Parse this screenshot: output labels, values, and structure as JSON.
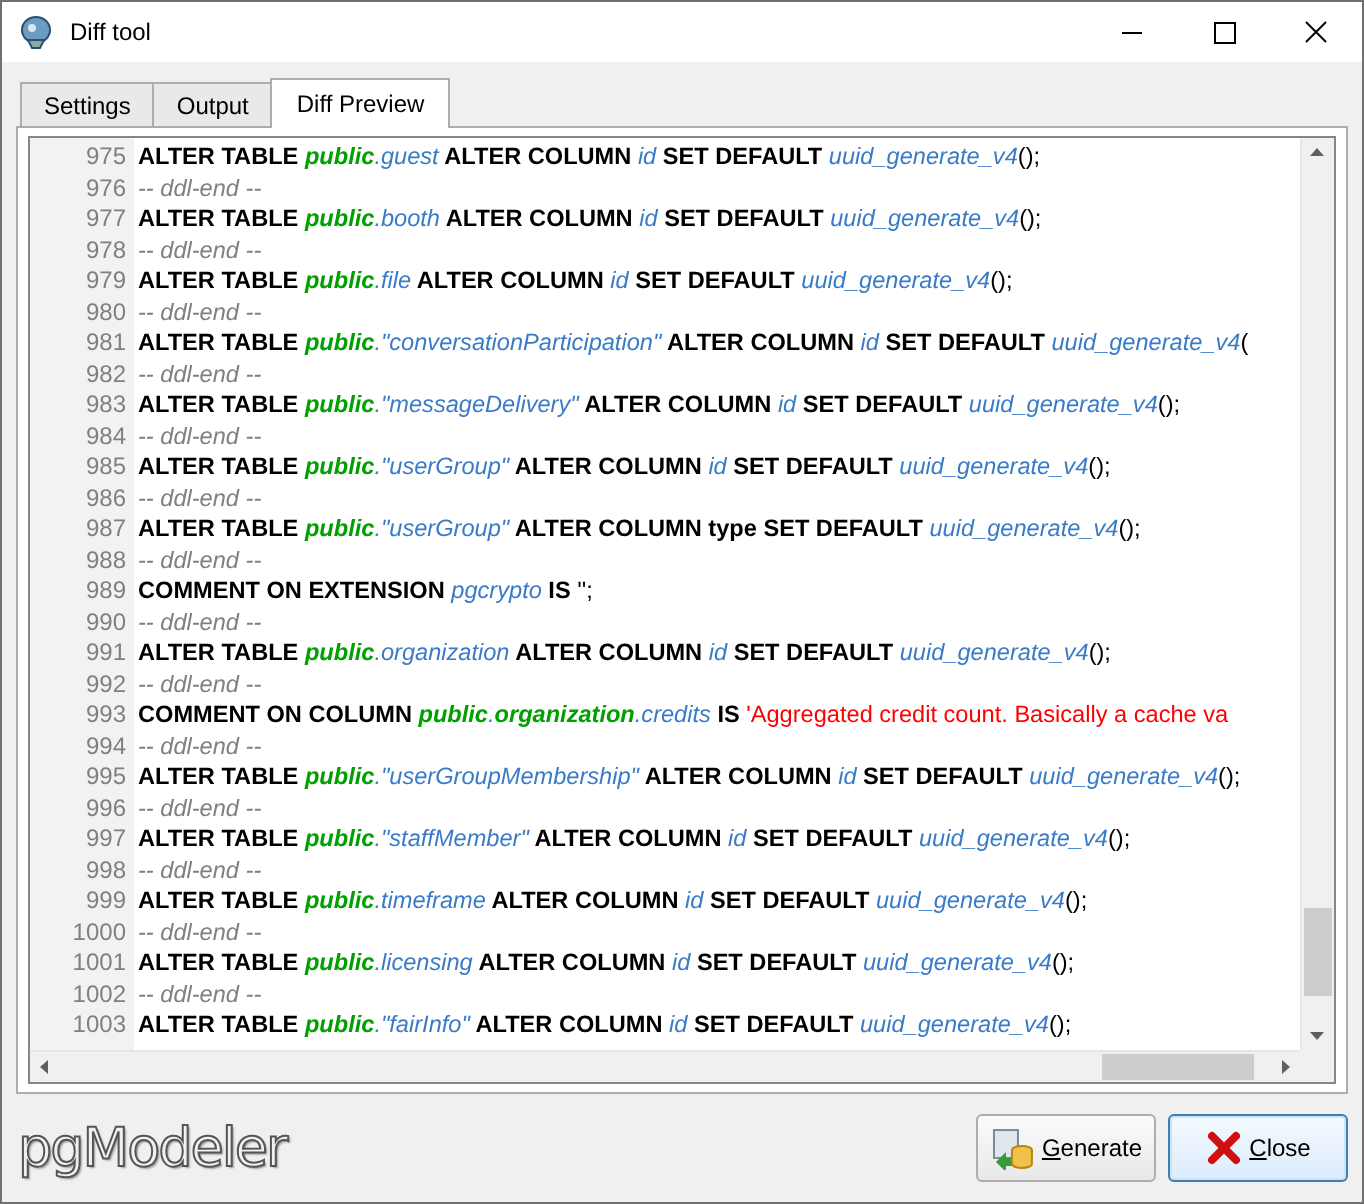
{
  "window": {
    "title": "Diff tool"
  },
  "tabs": [
    {
      "label": "Settings",
      "selected": false
    },
    {
      "label": "Output",
      "selected": false
    },
    {
      "label": "Diff Preview",
      "selected": true
    }
  ],
  "code_lines": [
    {
      "number": "975",
      "segments": [
        {
          "kind": "keyword",
          "text": "ALTER TABLE "
        },
        {
          "kind": "schema",
          "text": "public"
        },
        {
          "kind": "ident",
          "text": ".guest"
        },
        {
          "kind": "keyword",
          "text": " ALTER COLUMN "
        },
        {
          "kind": "ident",
          "text": "id"
        },
        {
          "kind": "keyword",
          "text": " SET DEFAULT "
        },
        {
          "kind": "ident",
          "text": "uuid_generate_v4"
        },
        {
          "kind": "plain",
          "text": "();"
        }
      ]
    },
    {
      "number": "976",
      "segments": [
        {
          "kind": "comment",
          "text": "-- ddl-end --"
        }
      ]
    },
    {
      "number": "977",
      "segments": [
        {
          "kind": "keyword",
          "text": "ALTER TABLE "
        },
        {
          "kind": "schema",
          "text": "public"
        },
        {
          "kind": "ident",
          "text": ".booth"
        },
        {
          "kind": "keyword",
          "text": " ALTER COLUMN "
        },
        {
          "kind": "ident",
          "text": "id"
        },
        {
          "kind": "keyword",
          "text": " SET DEFAULT "
        },
        {
          "kind": "ident",
          "text": "uuid_generate_v4"
        },
        {
          "kind": "plain",
          "text": "();"
        }
      ]
    },
    {
      "number": "978",
      "segments": [
        {
          "kind": "comment",
          "text": "-- ddl-end --"
        }
      ]
    },
    {
      "number": "979",
      "segments": [
        {
          "kind": "keyword",
          "text": "ALTER TABLE "
        },
        {
          "kind": "schema",
          "text": "public"
        },
        {
          "kind": "ident",
          "text": ".file"
        },
        {
          "kind": "keyword",
          "text": " ALTER COLUMN "
        },
        {
          "kind": "ident",
          "text": "id"
        },
        {
          "kind": "keyword",
          "text": " SET DEFAULT "
        },
        {
          "kind": "ident",
          "text": "uuid_generate_v4"
        },
        {
          "kind": "plain",
          "text": "();"
        }
      ]
    },
    {
      "number": "980",
      "segments": [
        {
          "kind": "comment",
          "text": "-- ddl-end --"
        }
      ]
    },
    {
      "number": "981",
      "segments": [
        {
          "kind": "keyword",
          "text": "ALTER TABLE "
        },
        {
          "kind": "schema",
          "text": "public"
        },
        {
          "kind": "ident",
          "text": ".\"conversationParticipation\""
        },
        {
          "kind": "keyword",
          "text": " ALTER COLUMN "
        },
        {
          "kind": "ident",
          "text": "id"
        },
        {
          "kind": "keyword",
          "text": " SET DEFAULT "
        },
        {
          "kind": "ident",
          "text": "uuid_generate_v4"
        },
        {
          "kind": "plain",
          "text": "("
        }
      ]
    },
    {
      "number": "982",
      "segments": [
        {
          "kind": "comment",
          "text": "-- ddl-end --"
        }
      ]
    },
    {
      "number": "983",
      "segments": [
        {
          "kind": "keyword",
          "text": "ALTER TABLE "
        },
        {
          "kind": "schema",
          "text": "public"
        },
        {
          "kind": "ident",
          "text": ".\"messageDelivery\""
        },
        {
          "kind": "keyword",
          "text": " ALTER COLUMN "
        },
        {
          "kind": "ident",
          "text": "id"
        },
        {
          "kind": "keyword",
          "text": " SET DEFAULT "
        },
        {
          "kind": "ident",
          "text": "uuid_generate_v4"
        },
        {
          "kind": "plain",
          "text": "();"
        }
      ]
    },
    {
      "number": "984",
      "segments": [
        {
          "kind": "comment",
          "text": "-- ddl-end --"
        }
      ]
    },
    {
      "number": "985",
      "segments": [
        {
          "kind": "keyword",
          "text": "ALTER TABLE "
        },
        {
          "kind": "schema",
          "text": "public"
        },
        {
          "kind": "ident",
          "text": ".\"userGroup\""
        },
        {
          "kind": "keyword",
          "text": " ALTER COLUMN "
        },
        {
          "kind": "ident",
          "text": "id"
        },
        {
          "kind": "keyword",
          "text": " SET DEFAULT "
        },
        {
          "kind": "ident",
          "text": "uuid_generate_v4"
        },
        {
          "kind": "plain",
          "text": "();"
        }
      ]
    },
    {
      "number": "986",
      "segments": [
        {
          "kind": "comment",
          "text": "-- ddl-end --"
        }
      ]
    },
    {
      "number": "987",
      "segments": [
        {
          "kind": "keyword",
          "text": "ALTER TABLE "
        },
        {
          "kind": "schema",
          "text": "public"
        },
        {
          "kind": "ident",
          "text": ".\"userGroup\""
        },
        {
          "kind": "keyword",
          "text": " ALTER COLUMN type SET DEFAULT "
        },
        {
          "kind": "ident",
          "text": "uuid_generate_v4"
        },
        {
          "kind": "plain",
          "text": "();"
        }
      ]
    },
    {
      "number": "988",
      "segments": [
        {
          "kind": "comment",
          "text": "-- ddl-end --"
        }
      ]
    },
    {
      "number": "989",
      "segments": [
        {
          "kind": "keyword",
          "text": "COMMENT ON EXTENSION "
        },
        {
          "kind": "ident",
          "text": "pgcrypto"
        },
        {
          "kind": "keyword",
          "text": " IS "
        },
        {
          "kind": "plain",
          "text": "'';"
        }
      ]
    },
    {
      "number": "990",
      "segments": [
        {
          "kind": "comment",
          "text": "-- ddl-end --"
        }
      ]
    },
    {
      "number": "991",
      "segments": [
        {
          "kind": "keyword",
          "text": "ALTER TABLE "
        },
        {
          "kind": "schema",
          "text": "public"
        },
        {
          "kind": "ident",
          "text": ".organization"
        },
        {
          "kind": "keyword",
          "text": " ALTER COLUMN "
        },
        {
          "kind": "ident",
          "text": "id"
        },
        {
          "kind": "keyword",
          "text": " SET DEFAULT "
        },
        {
          "kind": "ident",
          "text": "uuid_generate_v4"
        },
        {
          "kind": "plain",
          "text": "();"
        }
      ]
    },
    {
      "number": "992",
      "segments": [
        {
          "kind": "comment",
          "text": "-- ddl-end --"
        }
      ]
    },
    {
      "number": "993",
      "segments": [
        {
          "kind": "keyword",
          "text": "COMMENT ON COLUMN "
        },
        {
          "kind": "schema",
          "text": "public"
        },
        {
          "kind": "ident",
          "text": "."
        },
        {
          "kind": "schema",
          "text": "organization"
        },
        {
          "kind": "ident",
          "text": ".credits"
        },
        {
          "kind": "keyword",
          "text": " IS "
        },
        {
          "kind": "string",
          "text": "'Aggregated credit count. Basically a cache va"
        }
      ]
    },
    {
      "number": "994",
      "segments": [
        {
          "kind": "comment",
          "text": "-- ddl-end --"
        }
      ]
    },
    {
      "number": "995",
      "segments": [
        {
          "kind": "keyword",
          "text": "ALTER TABLE "
        },
        {
          "kind": "schema",
          "text": "public"
        },
        {
          "kind": "ident",
          "text": ".\"userGroupMembership\""
        },
        {
          "kind": "keyword",
          "text": " ALTER COLUMN "
        },
        {
          "kind": "ident",
          "text": "id"
        },
        {
          "kind": "keyword",
          "text": " SET DEFAULT "
        },
        {
          "kind": "ident",
          "text": "uuid_generate_v4"
        },
        {
          "kind": "plain",
          "text": "();"
        }
      ]
    },
    {
      "number": "996",
      "segments": [
        {
          "kind": "comment",
          "text": "-- ddl-end --"
        }
      ]
    },
    {
      "number": "997",
      "segments": [
        {
          "kind": "keyword",
          "text": "ALTER TABLE "
        },
        {
          "kind": "schema",
          "text": "public"
        },
        {
          "kind": "ident",
          "text": ".\"staffMember\""
        },
        {
          "kind": "keyword",
          "text": " ALTER COLUMN "
        },
        {
          "kind": "ident",
          "text": "id"
        },
        {
          "kind": "keyword",
          "text": " SET DEFAULT "
        },
        {
          "kind": "ident",
          "text": "uuid_generate_v4"
        },
        {
          "kind": "plain",
          "text": "();"
        }
      ]
    },
    {
      "number": "998",
      "segments": [
        {
          "kind": "comment",
          "text": "-- ddl-end --"
        }
      ]
    },
    {
      "number": "999",
      "segments": [
        {
          "kind": "keyword",
          "text": "ALTER TABLE "
        },
        {
          "kind": "schema",
          "text": "public"
        },
        {
          "kind": "ident",
          "text": ".timeframe"
        },
        {
          "kind": "keyword",
          "text": " ALTER COLUMN "
        },
        {
          "kind": "ident",
          "text": "id"
        },
        {
          "kind": "keyword",
          "text": " SET DEFAULT "
        },
        {
          "kind": "ident",
          "text": "uuid_generate_v4"
        },
        {
          "kind": "plain",
          "text": "();"
        }
      ]
    },
    {
      "number": "1000",
      "segments": [
        {
          "kind": "comment",
          "text": "-- ddl-end --"
        }
      ]
    },
    {
      "number": "1001",
      "segments": [
        {
          "kind": "keyword",
          "text": "ALTER TABLE "
        },
        {
          "kind": "schema",
          "text": "public"
        },
        {
          "kind": "ident",
          "text": ".licensing"
        },
        {
          "kind": "keyword",
          "text": " ALTER COLUMN "
        },
        {
          "kind": "ident",
          "text": "id"
        },
        {
          "kind": "keyword",
          "text": " SET DEFAULT "
        },
        {
          "kind": "ident",
          "text": "uuid_generate_v4"
        },
        {
          "kind": "plain",
          "text": "();"
        }
      ]
    },
    {
      "number": "1002",
      "segments": [
        {
          "kind": "comment",
          "text": "-- ddl-end --"
        }
      ]
    },
    {
      "number": "1003",
      "segments": [
        {
          "kind": "keyword",
          "text": "ALTER TABLE "
        },
        {
          "kind": "schema",
          "text": "public"
        },
        {
          "kind": "ident",
          "text": ".\"fairInfo\""
        },
        {
          "kind": "keyword",
          "text": " ALTER COLUMN "
        },
        {
          "kind": "ident",
          "text": "id"
        },
        {
          "kind": "keyword",
          "text": " SET DEFAULT "
        },
        {
          "kind": "ident",
          "text": "uuid_generate_v4"
        },
        {
          "kind": "plain",
          "text": "();"
        }
      ]
    }
  ],
  "logo": "pgModeler",
  "buttons": [
    {
      "kind": "generate",
      "label": "Generate",
      "focused": false
    },
    {
      "kind": "close",
      "label": "Close",
      "focused": true
    }
  ]
}
